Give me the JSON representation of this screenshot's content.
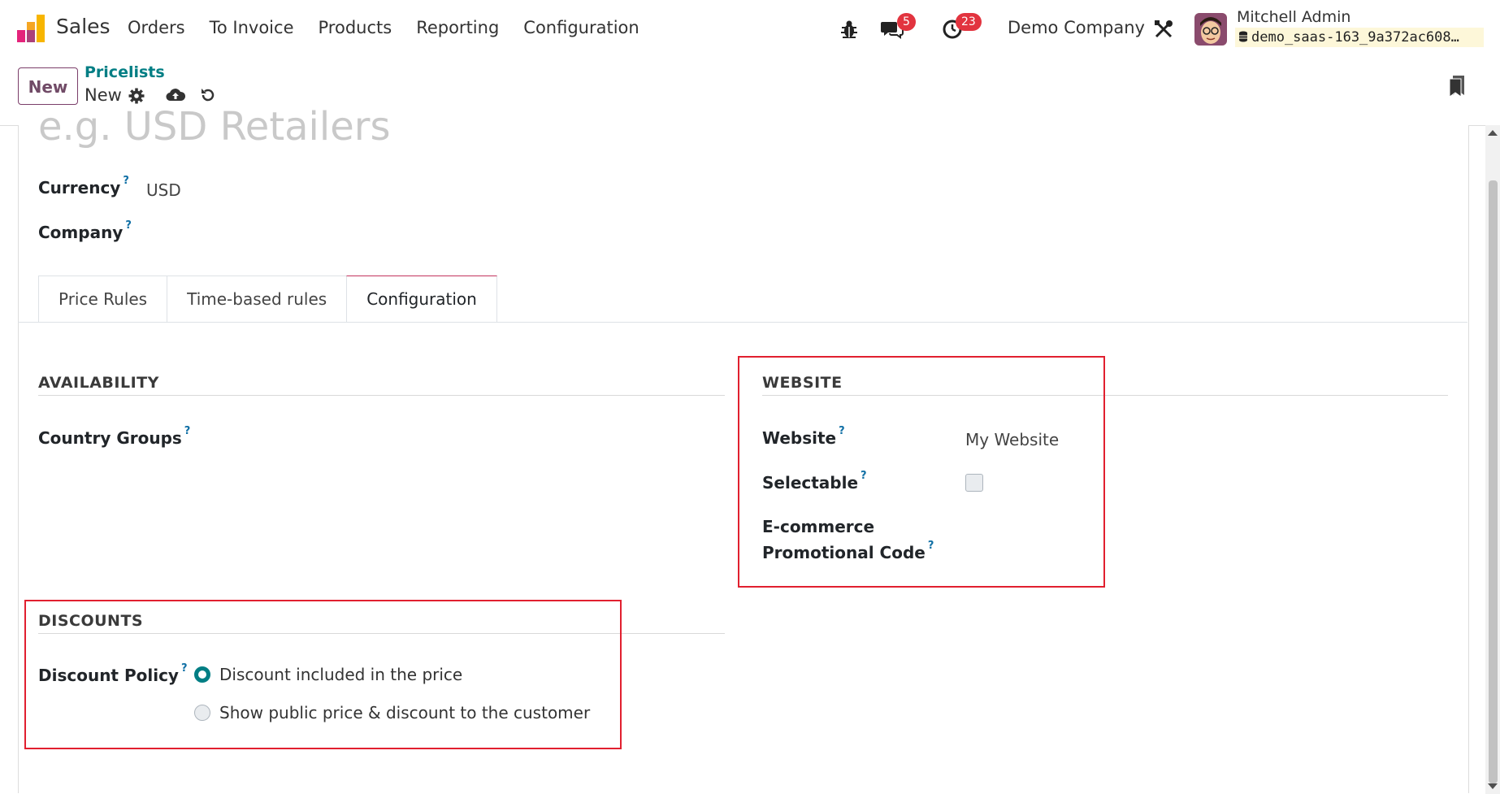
{
  "navbar": {
    "app_name": "Sales",
    "menu": [
      "Orders",
      "To Invoice",
      "Products",
      "Reporting",
      "Configuration"
    ],
    "messages_count": "5",
    "activities_count": "23",
    "company": "Demo Company",
    "user_name": "Mitchell Admin",
    "database": "demo_saas-163_9a372ac608…"
  },
  "control_panel": {
    "new_label": "New",
    "breadcrumb": "Pricelists",
    "record_name": "New"
  },
  "form": {
    "name_placeholder": "e.g. USD Retailers",
    "currency_label": "Currency",
    "currency_value": "USD",
    "company_label": "Company",
    "tabs": [
      "Price Rules",
      "Time-based rules",
      "Configuration"
    ],
    "active_tab": "Configuration",
    "availability": {
      "title": "AVAILABILITY",
      "country_groups_label": "Country Groups"
    },
    "website": {
      "title": "WEBSITE",
      "website_label": "Website",
      "website_value": "My Website",
      "selectable_label": "Selectable",
      "selectable_checked": false,
      "promo_label_line1": "E-commerce",
      "promo_label_line2": "Promotional Code"
    },
    "discounts": {
      "title": "DISCOUNTS",
      "policy_label": "Discount Policy",
      "options": [
        "Discount included in the price",
        "Show public price & discount to the customer"
      ],
      "selected": "Discount included in the price"
    }
  },
  "colors": {
    "brand": "#714b67",
    "accent": "#017e84",
    "highlight_box": "#e1202f",
    "badge": "#e2343f"
  }
}
